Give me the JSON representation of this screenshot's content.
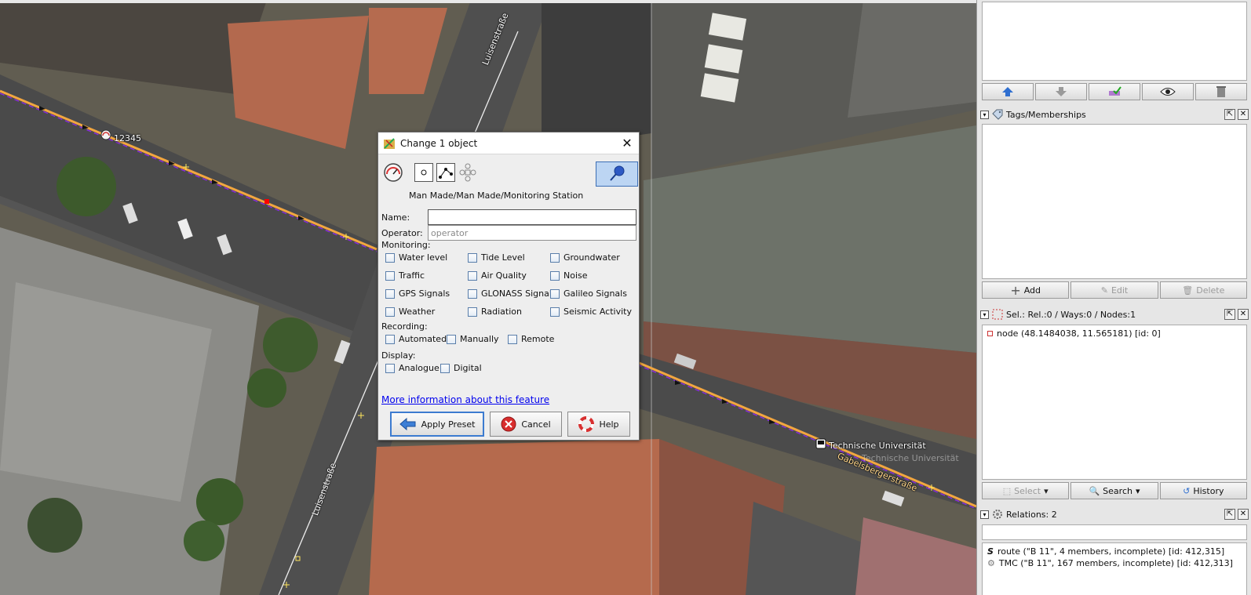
{
  "map": {
    "node_label": "12345",
    "stop_label": "Technische Universität",
    "stop_label_shadow": "Technische Universität",
    "street_top": "Luisenstraße",
    "street_bottom": "Luisenstraße",
    "street_right": "Gabelsbergerstraße"
  },
  "dialog": {
    "title": "Change 1 object",
    "preset_path": "Man Made/Man Made/Monitoring Station",
    "name_label": "Name:",
    "name_value": "",
    "operator_label": "Operator:",
    "operator_placeholder": "operator",
    "monitoring_label": "Monitoring:",
    "monitoring_options": [
      "Water level",
      "Tide Level",
      "Groundwater",
      "Traffic",
      "Air Quality",
      "Noise",
      "GPS Signals",
      "GLONASS Signals",
      "Galileo Signals",
      "Weather",
      "Radiation",
      "Seismic Activity"
    ],
    "recording_label": "Recording:",
    "recording_options": [
      "Automated",
      "Manually",
      "Remote"
    ],
    "display_label": "Display:",
    "display_options": [
      "Analogue",
      "Digital"
    ],
    "more_info_link": "More information about this feature",
    "buttons": {
      "apply": "Apply Preset",
      "cancel": "Cancel",
      "help": "Help"
    }
  },
  "panels": {
    "tags": {
      "title": "Tags/Memberships",
      "buttons": {
        "add": "Add",
        "edit": "Edit",
        "delete": "Delete"
      }
    },
    "selection": {
      "title": "Sel.: Rel.:0 / Ways:0 / Nodes:1",
      "items": [
        "node (48.1484038, 11.565181) [id: 0]"
      ],
      "buttons": {
        "select": "Select",
        "search": "Search",
        "history": "History"
      }
    },
    "relations": {
      "title": "Relations: 2",
      "items": [
        "route (\"B 11\", 4 members, incomplete) [id: 412,315]",
        "TMC (\"B 11\", 167 members, incomplete) [id: 412,313]"
      ]
    }
  },
  "colors": {
    "accent": "#3c7bd0",
    "route_line": "#f2a640",
    "route_dash": "#8a2be2",
    "link": "#0000ee"
  }
}
